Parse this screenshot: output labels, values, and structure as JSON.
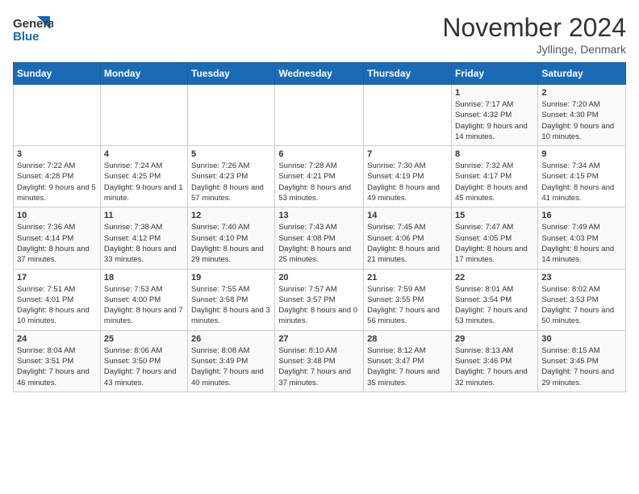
{
  "logo": {
    "general": "General",
    "blue": "Blue"
  },
  "title": "November 2024",
  "location": "Jyllinge, Denmark",
  "days_header": [
    "Sunday",
    "Monday",
    "Tuesday",
    "Wednesday",
    "Thursday",
    "Friday",
    "Saturday"
  ],
  "weeks": [
    [
      {
        "day": "",
        "info": ""
      },
      {
        "day": "",
        "info": ""
      },
      {
        "day": "",
        "info": ""
      },
      {
        "day": "",
        "info": ""
      },
      {
        "day": "",
        "info": ""
      },
      {
        "day": "1",
        "info": "Sunrise: 7:17 AM\nSunset: 4:32 PM\nDaylight: 9 hours and 14 minutes."
      },
      {
        "day": "2",
        "info": "Sunrise: 7:20 AM\nSunset: 4:30 PM\nDaylight: 9 hours and 10 minutes."
      }
    ],
    [
      {
        "day": "3",
        "info": "Sunrise: 7:22 AM\nSunset: 4:28 PM\nDaylight: 9 hours and 5 minutes."
      },
      {
        "day": "4",
        "info": "Sunrise: 7:24 AM\nSunset: 4:25 PM\nDaylight: 9 hours and 1 minute."
      },
      {
        "day": "5",
        "info": "Sunrise: 7:26 AM\nSunset: 4:23 PM\nDaylight: 8 hours and 57 minutes."
      },
      {
        "day": "6",
        "info": "Sunrise: 7:28 AM\nSunset: 4:21 PM\nDaylight: 8 hours and 53 minutes."
      },
      {
        "day": "7",
        "info": "Sunrise: 7:30 AM\nSunset: 4:19 PM\nDaylight: 8 hours and 49 minutes."
      },
      {
        "day": "8",
        "info": "Sunrise: 7:32 AM\nSunset: 4:17 PM\nDaylight: 8 hours and 45 minutes."
      },
      {
        "day": "9",
        "info": "Sunrise: 7:34 AM\nSunset: 4:15 PM\nDaylight: 8 hours and 41 minutes."
      }
    ],
    [
      {
        "day": "10",
        "info": "Sunrise: 7:36 AM\nSunset: 4:14 PM\nDaylight: 8 hours and 37 minutes."
      },
      {
        "day": "11",
        "info": "Sunrise: 7:38 AM\nSunset: 4:12 PM\nDaylight: 8 hours and 33 minutes."
      },
      {
        "day": "12",
        "info": "Sunrise: 7:40 AM\nSunset: 4:10 PM\nDaylight: 8 hours and 29 minutes."
      },
      {
        "day": "13",
        "info": "Sunrise: 7:43 AM\nSunset: 4:08 PM\nDaylight: 8 hours and 25 minutes."
      },
      {
        "day": "14",
        "info": "Sunrise: 7:45 AM\nSunset: 4:06 PM\nDaylight: 8 hours and 21 minutes."
      },
      {
        "day": "15",
        "info": "Sunrise: 7:47 AM\nSunset: 4:05 PM\nDaylight: 8 hours and 17 minutes."
      },
      {
        "day": "16",
        "info": "Sunrise: 7:49 AM\nSunset: 4:03 PM\nDaylight: 8 hours and 14 minutes."
      }
    ],
    [
      {
        "day": "17",
        "info": "Sunrise: 7:51 AM\nSunset: 4:01 PM\nDaylight: 8 hours and 10 minutes."
      },
      {
        "day": "18",
        "info": "Sunrise: 7:53 AM\nSunset: 4:00 PM\nDaylight: 8 hours and 7 minutes."
      },
      {
        "day": "19",
        "info": "Sunrise: 7:55 AM\nSunset: 3:58 PM\nDaylight: 8 hours and 3 minutes."
      },
      {
        "day": "20",
        "info": "Sunrise: 7:57 AM\nSunset: 3:57 PM\nDaylight: 8 hours and 0 minutes."
      },
      {
        "day": "21",
        "info": "Sunrise: 7:59 AM\nSunset: 3:55 PM\nDaylight: 7 hours and 56 minutes."
      },
      {
        "day": "22",
        "info": "Sunrise: 8:01 AM\nSunset: 3:54 PM\nDaylight: 7 hours and 53 minutes."
      },
      {
        "day": "23",
        "info": "Sunrise: 8:02 AM\nSunset: 3:53 PM\nDaylight: 7 hours and 50 minutes."
      }
    ],
    [
      {
        "day": "24",
        "info": "Sunrise: 8:04 AM\nSunset: 3:51 PM\nDaylight: 7 hours and 46 minutes."
      },
      {
        "day": "25",
        "info": "Sunrise: 8:06 AM\nSunset: 3:50 PM\nDaylight: 7 hours and 43 minutes."
      },
      {
        "day": "26",
        "info": "Sunrise: 8:08 AM\nSunset: 3:49 PM\nDaylight: 7 hours and 40 minutes."
      },
      {
        "day": "27",
        "info": "Sunrise: 8:10 AM\nSunset: 3:48 PM\nDaylight: 7 hours and 37 minutes."
      },
      {
        "day": "28",
        "info": "Sunrise: 8:12 AM\nSunset: 3:47 PM\nDaylight: 7 hours and 35 minutes."
      },
      {
        "day": "29",
        "info": "Sunrise: 8:13 AM\nSunset: 3:46 PM\nDaylight: 7 hours and 32 minutes."
      },
      {
        "day": "30",
        "info": "Sunrise: 8:15 AM\nSunset: 3:45 PM\nDaylight: 7 hours and 29 minutes."
      }
    ]
  ]
}
